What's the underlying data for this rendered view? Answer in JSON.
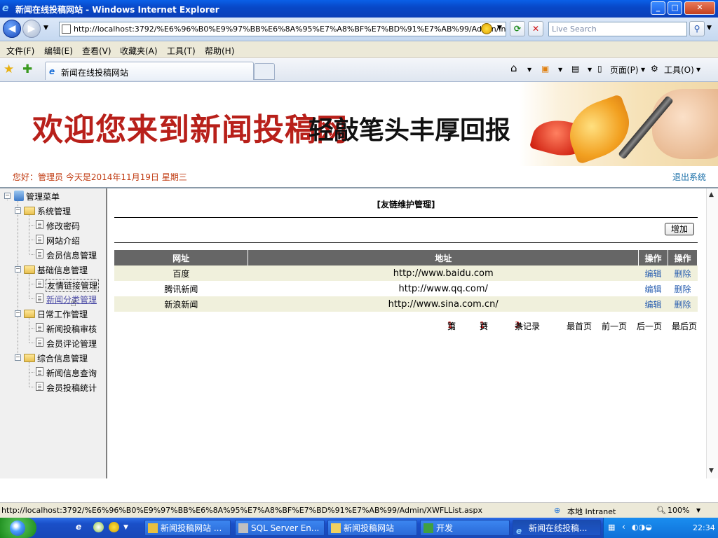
{
  "window": {
    "title": "新闻在线投稿网站 - Windows Internet Explorer",
    "address": "http://localhost:3792/%E6%96%B0%E9%97%BB%E6%8A%95%E7%A8%BF%E7%BD%91%E7%AB%99/Admin/inc",
    "search_placeholder": "Live Search"
  },
  "menu": [
    "文件(F)",
    "编辑(E)",
    "查看(V)",
    "收藏夹(A)",
    "工具(T)",
    "帮助(H)"
  ],
  "tab": {
    "label": "新闻在线投稿网站"
  },
  "toolbar": {
    "page": "页面(P)",
    "tools": "工具(O)"
  },
  "banner": {
    "headline": "欢迎您来到新闻投稿网",
    "slogan": "轻敲笔头丰厚回报"
  },
  "greeting": "您好：管理员    今天是2014年11月19日    星期三",
  "logout": "退出系统",
  "tree": {
    "root": "管理菜单",
    "groups": [
      {
        "label": "系统管理",
        "items": [
          "修改密码",
          "网站介绍",
          "会员信息管理"
        ]
      },
      {
        "label": "基础信息管理",
        "items": [
          "友情链接管理",
          "新闻分类管理"
        ]
      },
      {
        "label": "日常工作管理",
        "items": [
          "新闻投稿审核",
          "会员评论管理"
        ]
      },
      {
        "label": "综合信息管理",
        "items": [
          "新闻信息查询",
          "会员投稿统计"
        ]
      }
    ]
  },
  "main": {
    "title": "[友链维护管理]",
    "add_button": "增加",
    "columns": [
      "网址",
      "地址",
      "操作",
      "操作"
    ],
    "rows": [
      {
        "name": "百度",
        "url": "http://www.baidu.com",
        "edit": "编辑",
        "del": "删除"
      },
      {
        "name": "腾讯新闻",
        "url": "http://www.qq.com/",
        "edit": "编辑",
        "del": "删除"
      },
      {
        "name": "新浪新闻",
        "url": "http://www.sina.com.cn/",
        "edit": "编辑",
        "del": "删除"
      }
    ],
    "pager": {
      "p1": "第",
      "p1n": "1",
      "p1s": "页",
      "p2": "共",
      "p2n": "1",
      "p2s": "页",
      "p3": "共",
      "p3n": "3",
      "p3s": "条记录",
      "first": "最首页",
      "prev": "前一页",
      "next": "后一页",
      "last": "最后页"
    }
  },
  "status": {
    "url": "http://localhost:3792/%E6%96%B0%E9%97%BB%E6%8A%95%E7%A8%BF%E7%BD%91%E7%AB%99/Admin/XWFLList.aspx",
    "zone": "本地 Intranet",
    "zoom": "100%"
  },
  "taskbar": {
    "tasks": [
      "新闻投稿网站 ...",
      "SQL Server En...",
      "新闻投稿网站",
      "开发",
      "新闻在线投稿..."
    ],
    "clock": "22:34"
  }
}
